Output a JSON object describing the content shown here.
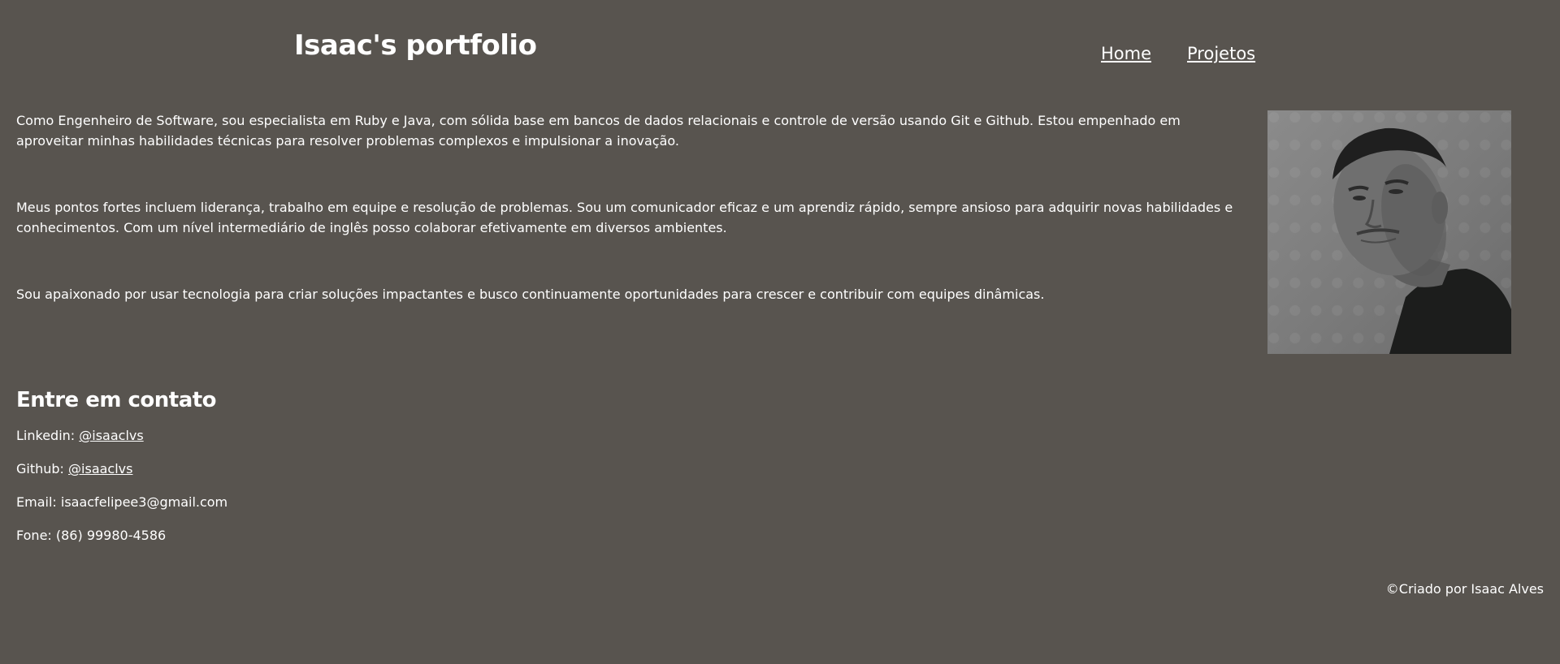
{
  "header": {
    "title": "Isaac's portfolio",
    "nav": [
      {
        "label": "Home"
      },
      {
        "label": "Projetos"
      }
    ]
  },
  "about": {
    "paragraphs": [
      "Como Engenheiro de Software, sou especialista em Ruby e Java, com sólida base em bancos de dados relacionais e controle de versão usando Git e Github. Estou empenhado em aproveitar minhas habilidades técnicas para resolver problemas complexos e impulsionar a inovação.",
      "Meus pontos fortes incluem liderança, trabalho em equipe e resolução de problemas. Sou um comunicador eficaz e um aprendiz rápido, sempre ansioso para adquirir novas habilidades e conhecimentos. Com um nível intermediário de inglês posso colaborar efetivamente em diversos ambientes.",
      "Sou apaixonado por usar tecnologia para criar soluções impactantes e busco continuamente oportunidades para crescer e contribuir com equipes dinâmicas."
    ]
  },
  "contact": {
    "heading": "Entre em contato",
    "linkedin_label": "Linkedin: ",
    "linkedin_handle": "@isaaclvs",
    "github_label": "Github: ",
    "github_handle": "@isaaclvs",
    "email": "Email: isaacfelipee3@gmail.com",
    "phone": "Fone: (86) 99980-4586"
  },
  "footer": {
    "text": "©Criado por Isaac Alves"
  },
  "colors": {
    "background": "#58544f",
    "text": "#ffffff"
  }
}
